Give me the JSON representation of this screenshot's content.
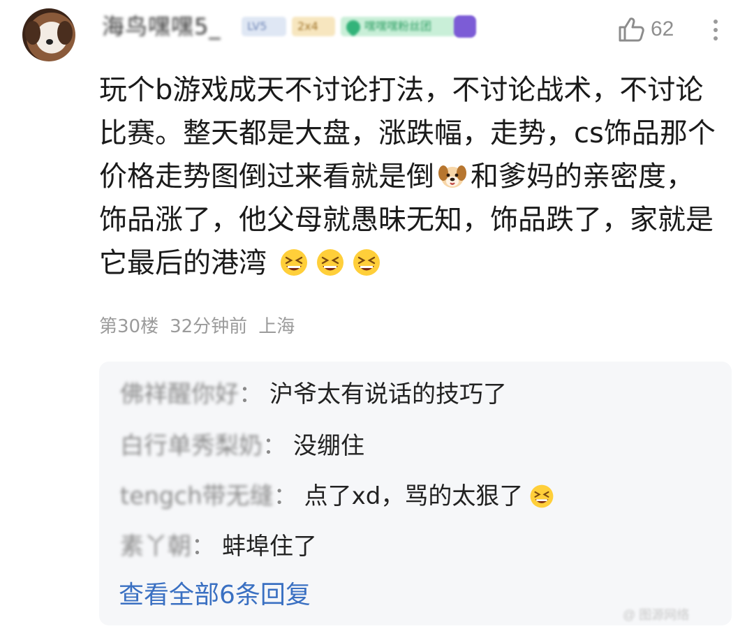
{
  "comment": {
    "username": "海鸟嘿嘿5_",
    "badges": {
      "level": "LV5",
      "grade": "2x4",
      "fan_medal": "嘿嘿嘿粉丝团"
    },
    "likes": "62",
    "text_lines": [
      "玩个b游戏成天不讨论打法，不讨论战术，不讨论",
      "比赛。整天都是大盘，涨跌幅，走势，cs饰品那个",
      "价格走势图倒过来看就是倒",
      "和爹妈的亲密度，",
      "饰品涨了，他父母就愚昧无知，饰品跌了，家就是",
      "它最后的港湾"
    ],
    "floor": "第30楼",
    "time": "32分钟前",
    "location": "上海",
    "emoji_inline": "dog-face",
    "emoji_trailing": "grinning-squinting-face"
  },
  "replies": {
    "items": [
      {
        "user": "佛祥醒你好",
        "sep": "：",
        "text": "沪爷太有说话的技巧了"
      },
      {
        "user": "白行单秀梨奶",
        "sep": "：",
        "text": "没绷住"
      },
      {
        "user": "tengch带无缝",
        "sep": "：",
        "text": "点了xd，骂的太狠了"
      },
      {
        "user": "素丫朝",
        "sep": "：",
        "text": "蚌埠住了"
      }
    ],
    "view_all": "查看全部6条回复"
  },
  "watermark": "@ 图源网络",
  "colors": {
    "link": "#3a70c2",
    "meta": "#9b9b9b",
    "reply_bg": "#f6f7f9"
  }
}
